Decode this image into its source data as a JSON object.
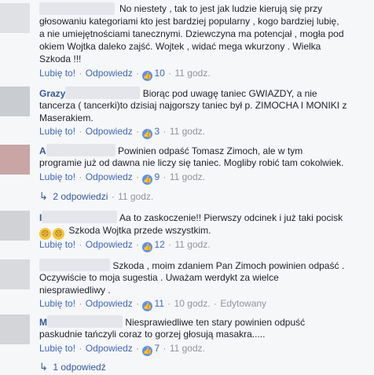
{
  "comments": [
    {
      "text": [
        "No niestety , tak to jest jak ludzie kierują się przy",
        "głosowaniu kategoriami kto jest bardziej popularny , kogo bardziej lubię,",
        "a nie umiejętnościami tanecznymi. Dziewczyna ma potencjał , mogła pod",
        "okiem Wojtka daleko zajść. Wojtek , widać mega wkurzony . Wielka",
        "Szkoda !!!"
      ],
      "like": "Lubię to!",
      "reply": "Odpowiedz",
      "likes": "10",
      "time": "11 godz."
    },
    {
      "author": "Grazy",
      "text": [
        "Biorąc pod uwagę taniec GWIAZDY, a nie",
        "tancerza ( tancerki)to dzisiaj najgorszy taniec był p. ZIMOCHA I MONIKI z",
        "Maserakiem."
      ],
      "like": "Lubię to!",
      "reply": "Odpowiedz",
      "likes": "3",
      "time": "11 godz."
    },
    {
      "author": "A",
      "text": [
        "Powinien odpaść Tomasz Zimoch, ale w tym",
        "programie już od dawna nie liczy się taniec. Mogliby robić tam cokolwiek."
      ],
      "like": "Lubię to!",
      "reply": "Odpowiedz",
      "likes": "9",
      "time": "11 godz.",
      "replies": "2 odpowiedzi",
      "replies_time": "11 godz."
    },
    {
      "author": "I",
      "text": [
        "Aa to zaskoczenie!! Pierwszy odcinek i już taki pocisk",
        "Szkoda Wojtka przede wszystkim."
      ],
      "like": "Lubię to!",
      "reply": "Odpowiedz",
      "likes": "12",
      "time": "11 godz."
    },
    {
      "text": [
        "Szkoda , moim zdaniem Pan Zimoch powinien odpaść .",
        "Oczywiście to moja sugestia . Uważam werdykt za wielce",
        "niesprawiedliwy ."
      ],
      "like": "Lubię to!",
      "reply": "Odpowiedz",
      "likes": "11",
      "time": "10 godz.",
      "edited": "Edytowany"
    },
    {
      "author": "M",
      "text": [
        "Niesprawiedliwe ten stary powinien odpuść",
        "paskudnie tańczyli coraz to gorzej głosują masakra....."
      ],
      "like": "Lubię to!",
      "reply": "Odpowiedz",
      "likes": "7",
      "time": "11 godz.",
      "replies": "1 odpowiedź"
    }
  ],
  "icons": {
    "like": "thumbs-up-icon",
    "reply_arrow": "reply-arrow-icon",
    "emoji": "sad-face-emoji-icon"
  },
  "colors": {
    "link": "#4267b2",
    "name": "#365899",
    "muted": "#90949c",
    "background": "#f6f7f9"
  }
}
